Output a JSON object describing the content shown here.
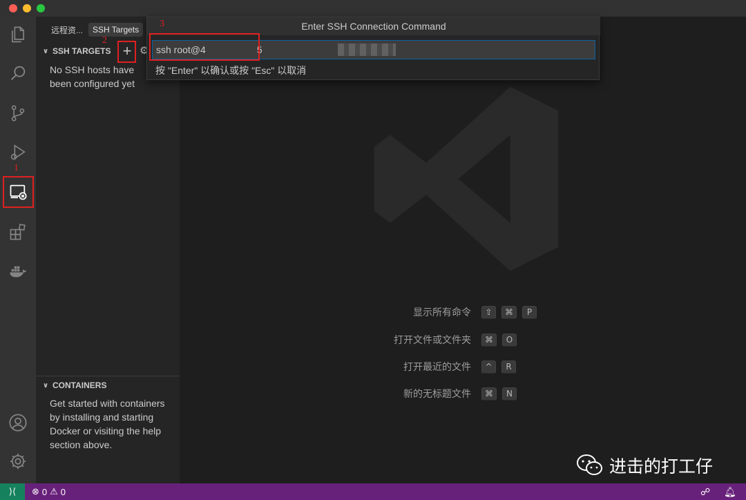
{
  "colors": {
    "accent_focus": "#0e639c",
    "status_bar": "#68217a",
    "remote_indicator": "#16825d",
    "annotation": "#e02020"
  },
  "activity_bar": {
    "items": [
      {
        "name": "explorer",
        "icon": "files-icon"
      },
      {
        "name": "search",
        "icon": "search-icon"
      },
      {
        "name": "source-control",
        "icon": "source-control-icon"
      },
      {
        "name": "run-debug",
        "icon": "run-debug-icon"
      },
      {
        "name": "remote-explorer",
        "icon": "remote-explorer-icon"
      },
      {
        "name": "extensions",
        "icon": "extensions-icon"
      },
      {
        "name": "docker",
        "icon": "docker-icon"
      }
    ],
    "bottom": [
      {
        "name": "accounts",
        "icon": "account-icon"
      },
      {
        "name": "manage",
        "icon": "gear-icon"
      }
    ]
  },
  "sidebar": {
    "dropdown_label": "远程资...",
    "selected_target": "SSH Targets",
    "ssh_section": {
      "title": "SSH TARGETS",
      "empty_message": "No SSH hosts have been configured yet"
    },
    "containers_section": {
      "title": "CONTAINERS",
      "message": "Get started with containers by installing and starting Docker or visiting the help section above."
    }
  },
  "quick_input": {
    "title": "Enter SSH Connection Command",
    "value": "ssh root@4",
    "value_suffix": "5",
    "hint": "按 \"Enter\" 以确认或按 \"Esc\" 以取消"
  },
  "annotations": [
    "1",
    "2",
    "3"
  ],
  "shortcuts": [
    {
      "label": "显示所有命令",
      "keys": [
        "⇧",
        "⌘",
        "P"
      ]
    },
    {
      "label": "打开文件或文件夹",
      "keys": [
        "⌘",
        "O"
      ]
    },
    {
      "label": "打开最近的文件",
      "keys": [
        "^",
        "R"
      ]
    },
    {
      "label": "新的无标题文件",
      "keys": [
        "⌘",
        "N"
      ]
    }
  ],
  "status_bar": {
    "remote_icon": "remote-indicator-icon",
    "errors": "0",
    "warnings": "0"
  },
  "watermark_text": "进击的打工仔"
}
